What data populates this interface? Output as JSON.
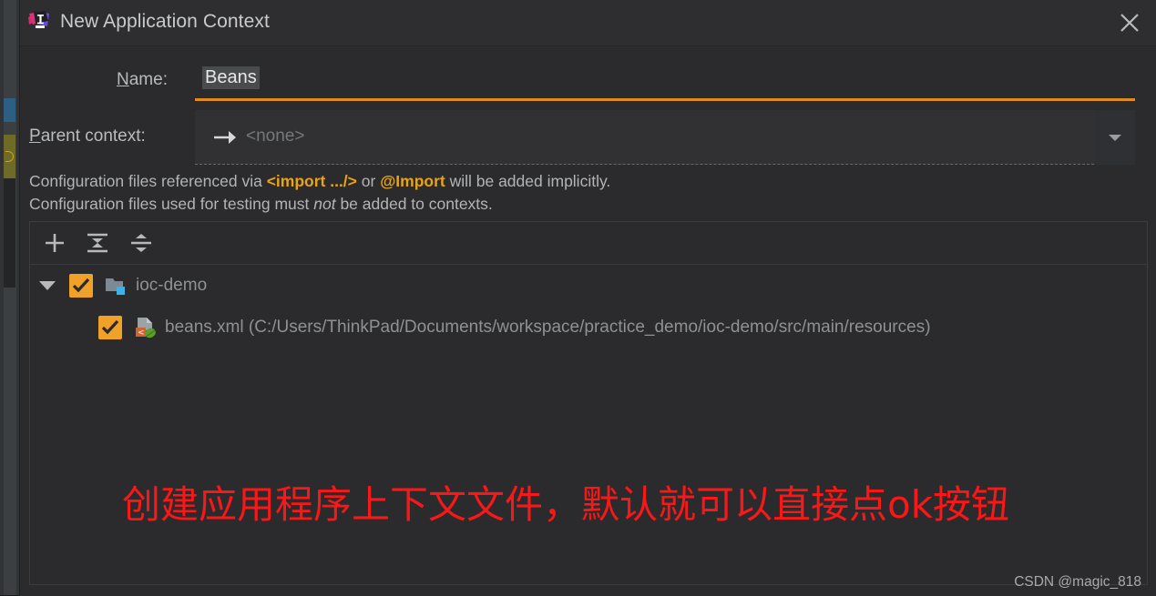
{
  "window": {
    "title": "New Application Context",
    "app_icon": "intellij-idea-logo",
    "close_label": "×"
  },
  "form": {
    "name_label_prefix": "N",
    "name_label_rest": "ame:",
    "name_value": "Beans",
    "parent_label_prefix": "P",
    "parent_label_rest": "arent context:",
    "parent_placeholder": "<none>",
    "parent_arrow_icon": "right-arrow-icon",
    "parent_dropdown_icon": "chevron-down-icon"
  },
  "hints": {
    "line1_part1": "Configuration files referenced via ",
    "line1_bold1": "<import .../>",
    "line1_part2": " or ",
    "line1_bold2": "@Import",
    "line1_part3": " will be added implicitly.",
    "line2_part1": "Configuration files used for testing must ",
    "line2_italic": "not",
    "line2_part2": " be added to contexts."
  },
  "toolbar": {
    "add_label": "add-configuration-file",
    "expand_label": "expand-all",
    "collapse_label": "collapse-all"
  },
  "tree": {
    "rows": [
      {
        "label": "ioc-demo",
        "icon": "module-folder-icon",
        "checked": true,
        "expanded": true,
        "level": 0
      },
      {
        "label": "beans.xml (C:/Users/ThinkPad/Documents/workspace/practice_demo/ioc-demo/src/main/resources)",
        "icon": "spring-xml-file-icon",
        "checked": true,
        "level": 1
      }
    ]
  },
  "annotation": {
    "text": "创建应用程序上下文文件，默认就可以直接点ok按钮",
    "color": "#f91717"
  },
  "watermark": {
    "text": "CSDN @magic_818"
  },
  "colors": {
    "dialog_bg": "#2b2b2e",
    "titlebar_bg": "#2e2e31",
    "accent_orange": "#e08b1c",
    "checkbox_orange": "#f0a228",
    "hint_bold": "#e8a317",
    "text_primary": "#b9bbbc",
    "text_muted": "#8f9193"
  }
}
